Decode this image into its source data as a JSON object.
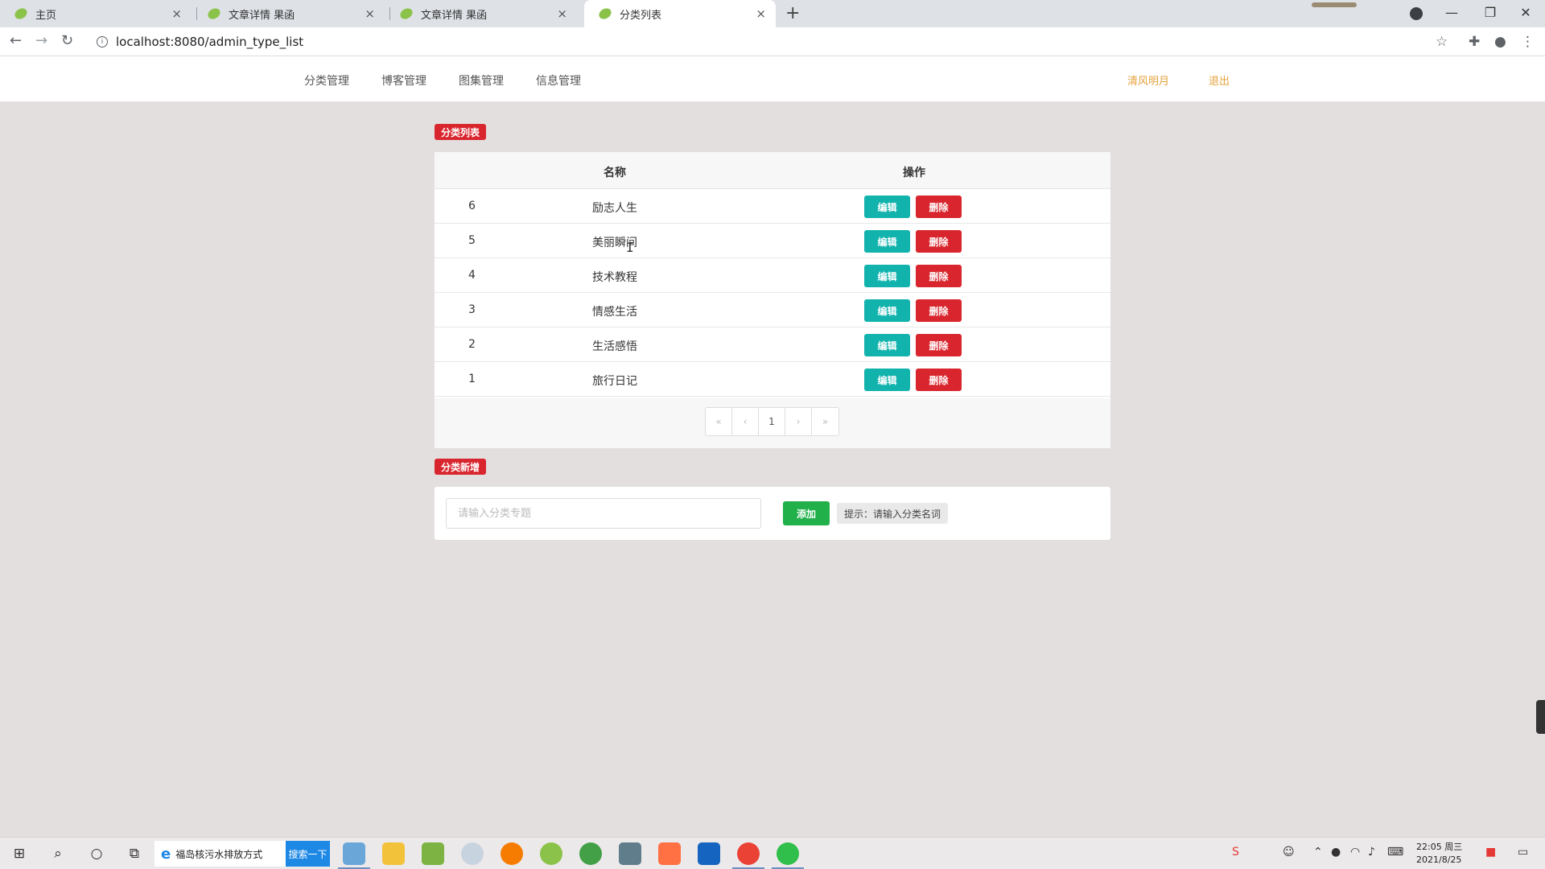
{
  "browser": {
    "tabs": [
      {
        "title": "主页",
        "close": "×"
      },
      {
        "title": "文章详情 果函",
        "close": "×"
      },
      {
        "title": "文章详情 果函",
        "close": "×"
      },
      {
        "title": "分类列表",
        "close": "×"
      }
    ],
    "new_tab": "+",
    "url": "localhost:8080/admin_type_list"
  },
  "nav": {
    "items": [
      "分类管理",
      "博客管理",
      "图集管理",
      "信息管理"
    ],
    "user": "清风明月",
    "logout": "退出"
  },
  "list": {
    "badge": "分类列表",
    "headers": {
      "name": "名称",
      "action": "操作"
    },
    "edit_label": "编辑",
    "delete_label": "删除",
    "rows": [
      {
        "id": "6",
        "name": "励志人生"
      },
      {
        "id": "5",
        "name": "美丽瞬间"
      },
      {
        "id": "4",
        "name": "技术教程"
      },
      {
        "id": "3",
        "name": "情感生活"
      },
      {
        "id": "2",
        "name": "生活感悟"
      },
      {
        "id": "1",
        "name": "旅行日记"
      }
    ],
    "pagination": {
      "first": "«",
      "prev": "‹",
      "current": "1",
      "next": "›",
      "last": "»"
    }
  },
  "add": {
    "badge": "分类新增",
    "placeholder": "请输入分类专题",
    "button": "添加",
    "hint": "提示：请输入分类名词"
  },
  "taskbar": {
    "search_text": "福岛核污水排放方式",
    "search_button": "搜索一下",
    "time": "22:05 周三",
    "date": "2021/8/25"
  },
  "colors": {
    "danger": "#d9262e",
    "edit": "#12b3ad",
    "add": "#21b04a",
    "user_link": "#e6a23c",
    "page_bg": "#e3dfdf"
  }
}
